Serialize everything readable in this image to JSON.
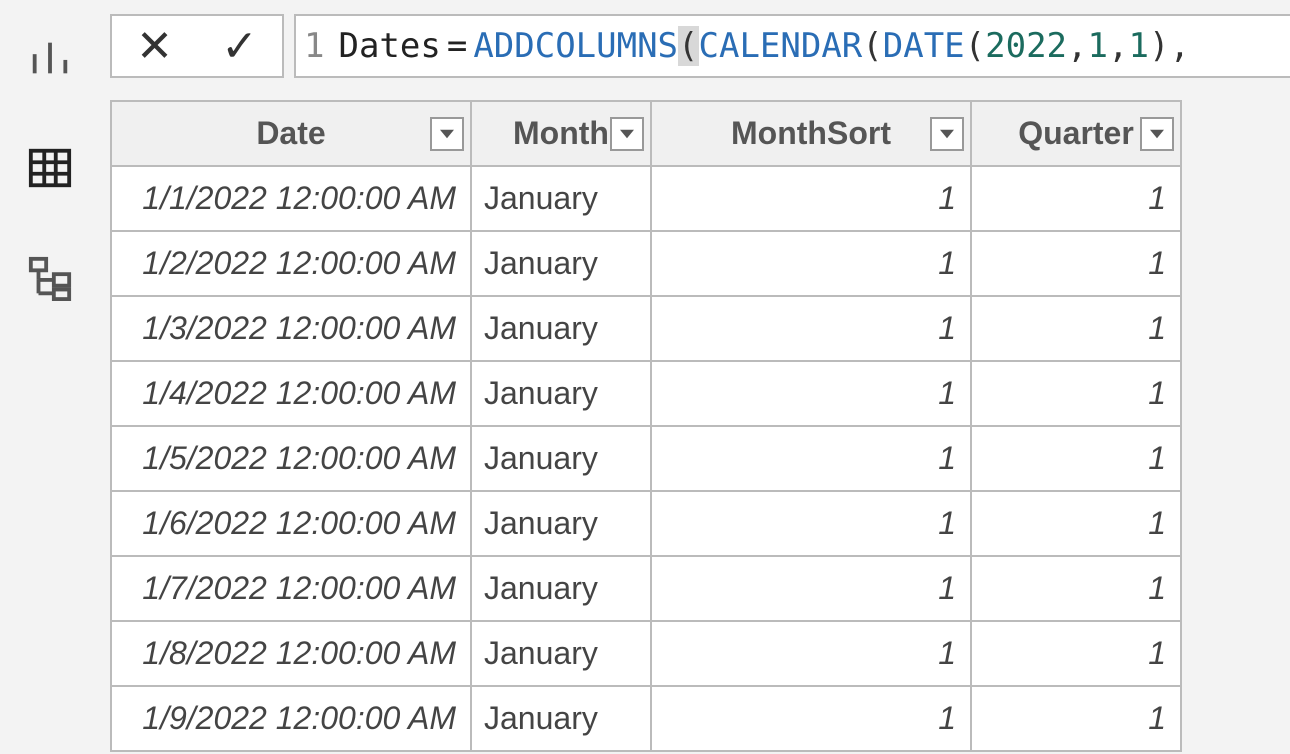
{
  "nav": {
    "report_tooltip": "Report",
    "data_tooltip": "Data",
    "model_tooltip": "Model"
  },
  "formula": {
    "line_number": "1",
    "table_name": "Dates",
    "equals": "=",
    "fn_addcolumns": "ADDCOLUMNS",
    "fn_calendar": "CALENDAR",
    "fn_date": "DATE",
    "num_year": "2022",
    "num_m": "1",
    "num_d": "1",
    "open_paren": "(",
    "close_paren": ")",
    "comma": ","
  },
  "columns": [
    {
      "key": "date",
      "label": "Date"
    },
    {
      "key": "month",
      "label": "Month"
    },
    {
      "key": "monthsort",
      "label": "MonthSort"
    },
    {
      "key": "quarter",
      "label": "Quarter"
    }
  ],
  "rows": [
    {
      "date": "1/1/2022 12:00:00 AM",
      "month": "January",
      "monthsort": "1",
      "quarter": "1"
    },
    {
      "date": "1/2/2022 12:00:00 AM",
      "month": "January",
      "monthsort": "1",
      "quarter": "1"
    },
    {
      "date": "1/3/2022 12:00:00 AM",
      "month": "January",
      "monthsort": "1",
      "quarter": "1"
    },
    {
      "date": "1/4/2022 12:00:00 AM",
      "month": "January",
      "monthsort": "1",
      "quarter": "1"
    },
    {
      "date": "1/5/2022 12:00:00 AM",
      "month": "January",
      "monthsort": "1",
      "quarter": "1"
    },
    {
      "date": "1/6/2022 12:00:00 AM",
      "month": "January",
      "monthsort": "1",
      "quarter": "1"
    },
    {
      "date": "1/7/2022 12:00:00 AM",
      "month": "January",
      "monthsort": "1",
      "quarter": "1"
    },
    {
      "date": "1/8/2022 12:00:00 AM",
      "month": "January",
      "monthsort": "1",
      "quarter": "1"
    },
    {
      "date": "1/9/2022 12:00:00 AM",
      "month": "January",
      "monthsort": "1",
      "quarter": "1"
    }
  ]
}
